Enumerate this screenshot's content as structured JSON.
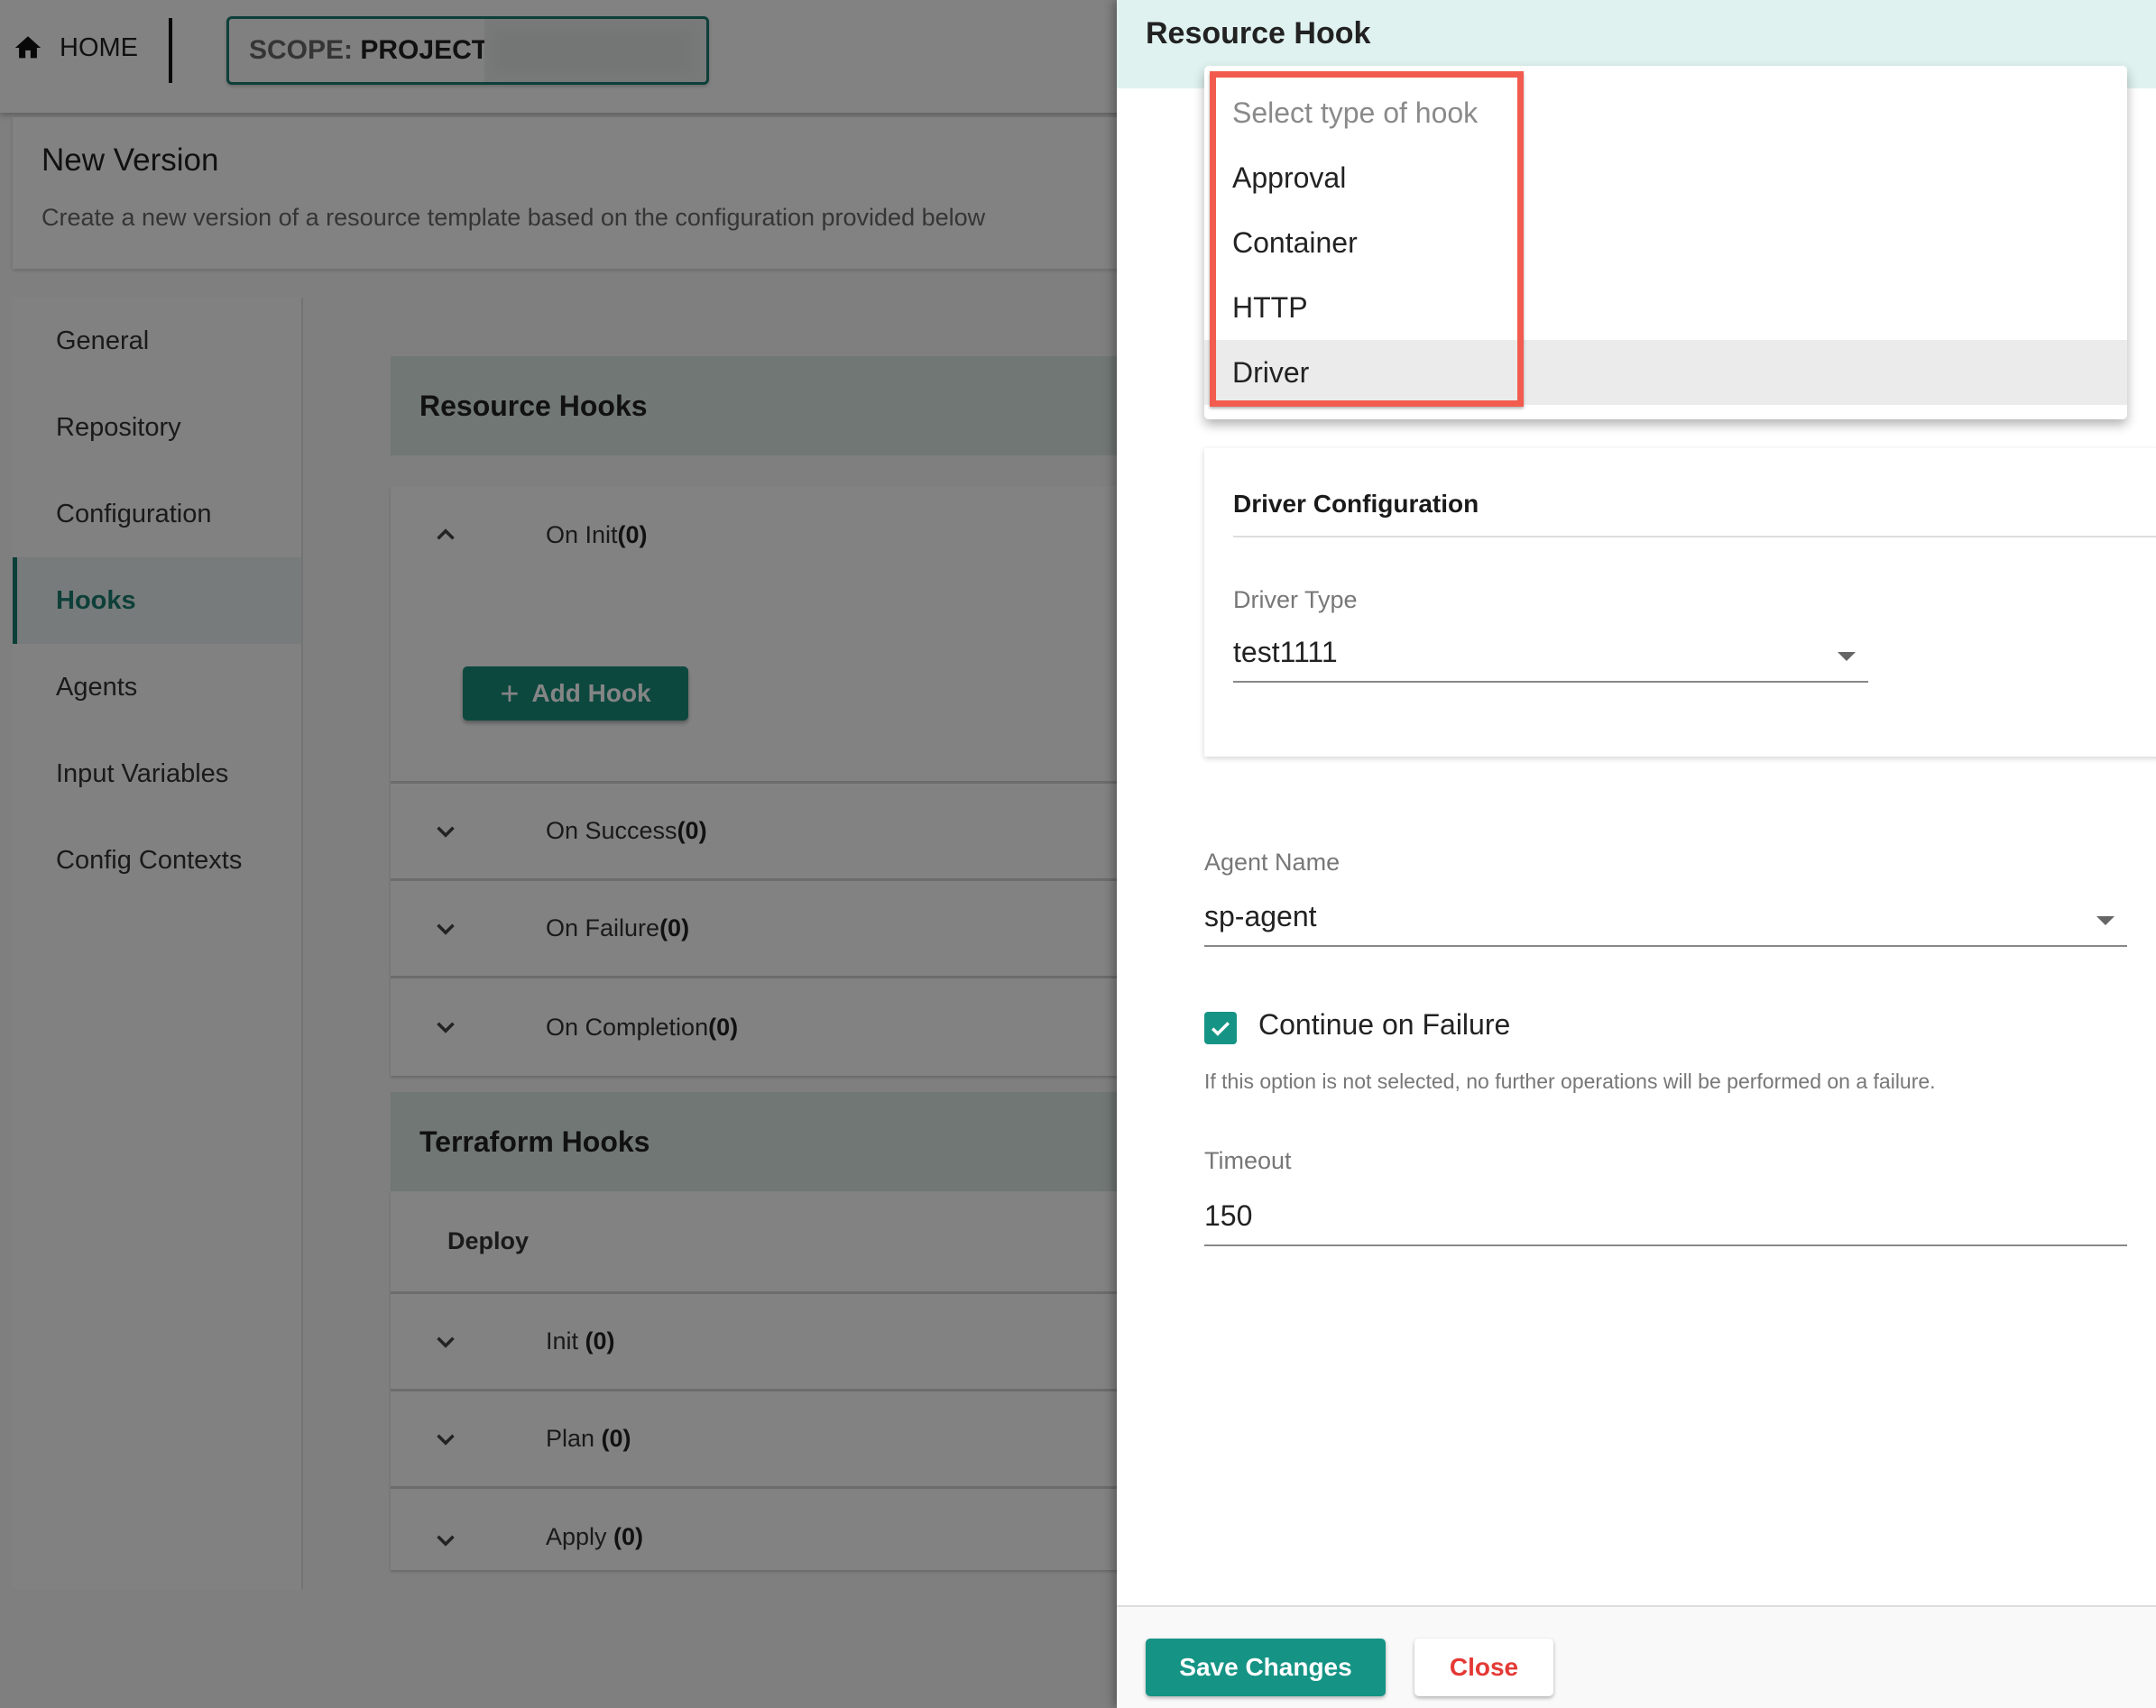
{
  "topbar": {
    "home_label": "HOME",
    "scope_prefix": "SCOPE:",
    "scope_value": "PROJECT"
  },
  "page": {
    "title": "New Version",
    "subtitle": "Create a new version of a resource template based on the configuration provided below"
  },
  "sidebar": {
    "items": [
      {
        "label": "General",
        "active": false
      },
      {
        "label": "Repository",
        "active": false
      },
      {
        "label": "Configuration",
        "active": false
      },
      {
        "label": "Hooks",
        "active": true
      },
      {
        "label": "Agents",
        "active": false
      },
      {
        "label": "Input Variables",
        "active": false
      },
      {
        "label": "Config Contexts",
        "active": false
      }
    ]
  },
  "resource_hooks": {
    "title": "Resource Hooks",
    "on_init": {
      "label": "On Init",
      "count": "(0)",
      "expanded": true
    },
    "add_hook_label": "Add Hook",
    "others": [
      {
        "label": "On Success",
        "count": "(0)"
      },
      {
        "label": "On Failure",
        "count": "(0)"
      },
      {
        "label": "On Completion",
        "count": "(0)"
      }
    ]
  },
  "terraform_hooks": {
    "title": "Terraform Hooks",
    "group": "Deploy",
    "items": [
      {
        "label": "Init ",
        "count": "(0)"
      },
      {
        "label": "Plan ",
        "count": "(0)"
      },
      {
        "label": "Apply ",
        "count": "(0)"
      }
    ]
  },
  "panel": {
    "title": "Resource Hook",
    "hook_type_menu": {
      "placeholder": "Select type of hook",
      "options": [
        "Approval",
        "Container",
        "HTTP",
        "Driver"
      ],
      "highlighted": "Driver"
    },
    "driver_config": {
      "title": "Driver Configuration",
      "driver_type_label": "Driver Type",
      "driver_type_value": "test1111"
    },
    "agent_name_label": "Agent Name",
    "agent_name_value": "sp-agent",
    "continue_on_failure_label": "Continue on Failure",
    "continue_on_failure_checked": true,
    "continue_on_failure_help": "If this option is not selected, no further operations will be performed on a failure.",
    "timeout_label": "Timeout",
    "timeout_value": "150",
    "save_label": "Save Changes",
    "close_label": "Close"
  },
  "colors": {
    "accent": "#159485",
    "panel_header": "#dff2ef",
    "close_text": "#e53935",
    "annotation_box": "#f25c4f"
  }
}
